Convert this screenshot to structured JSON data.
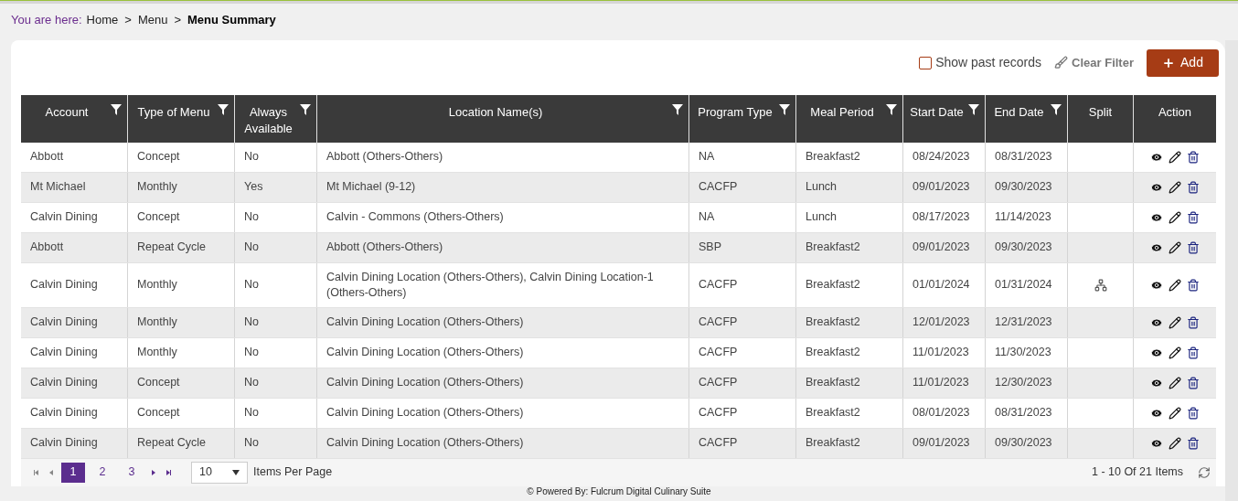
{
  "breadcrumb": {
    "prefix": "You are here:",
    "items": [
      {
        "label": "Home",
        "current": false
      },
      {
        "label": "Menu",
        "current": false
      },
      {
        "label": "Menu Summary",
        "current": true
      }
    ],
    "separator": ">"
  },
  "toolbar": {
    "show_past_records": {
      "label": "Show past records",
      "checked": false
    },
    "clear_filter": "Clear Filter",
    "add": "Add"
  },
  "table": {
    "columns": [
      {
        "label": "Account",
        "filter": true
      },
      {
        "label": "Type of Menu",
        "filter": true
      },
      {
        "label": "Always Available",
        "filter": true
      },
      {
        "label": "Location Name(s)",
        "filter": true
      },
      {
        "label": "Program Type",
        "filter": true
      },
      {
        "label": "Meal Period",
        "filter": true
      },
      {
        "label": "Start Date",
        "filter": true
      },
      {
        "label": "End Date",
        "filter": true
      },
      {
        "label": "Split",
        "filter": false
      },
      {
        "label": "Action",
        "filter": false
      }
    ],
    "rows": [
      {
        "cells": [
          "Abbott",
          "Concept",
          "No",
          "Abbott (Others-Others)",
          "NA",
          "Breakfast2",
          "08/24/2023",
          "08/31/2023"
        ],
        "split": false
      },
      {
        "cells": [
          "Mt Michael",
          "Monthly",
          "Yes",
          "Mt Michael (9-12)",
          "CACFP",
          "Lunch",
          "09/01/2023",
          "09/30/2023"
        ],
        "split": false
      },
      {
        "cells": [
          "Calvin Dining",
          "Concept",
          "No",
          "Calvin - Commons (Others-Others)",
          "NA",
          "Lunch",
          "08/17/2023",
          "11/14/2023"
        ],
        "split": false
      },
      {
        "cells": [
          "Abbott",
          "Repeat Cycle",
          "No",
          "Abbott (Others-Others)",
          "SBP",
          "Breakfast2",
          "09/01/2023",
          "09/30/2023"
        ],
        "split": false
      },
      {
        "cells": [
          "Calvin Dining",
          "Monthly",
          "No",
          "Calvin Dining Location (Others-Others), Calvin Dining Location-1 (Others-Others)",
          "CACFP",
          "Breakfast2",
          "01/01/2024",
          "01/31/2024"
        ],
        "split": true
      },
      {
        "cells": [
          "Calvin Dining",
          "Monthly",
          "No",
          "Calvin Dining Location (Others-Others)",
          "CACFP",
          "Breakfast2",
          "12/01/2023",
          "12/31/2023"
        ],
        "split": false
      },
      {
        "cells": [
          "Calvin Dining",
          "Monthly",
          "No",
          "Calvin Dining Location (Others-Others)",
          "CACFP",
          "Breakfast2",
          "11/01/2023",
          "11/30/2023"
        ],
        "split": false
      },
      {
        "cells": [
          "Calvin Dining",
          "Concept",
          "No",
          "Calvin Dining Location (Others-Others)",
          "CACFP",
          "Breakfast2",
          "11/01/2023",
          "12/30/2023"
        ],
        "split": false
      },
      {
        "cells": [
          "Calvin Dining",
          "Concept",
          "No",
          "Calvin Dining Location (Others-Others)",
          "CACFP",
          "Breakfast2",
          "08/01/2023",
          "08/31/2023"
        ],
        "split": false
      },
      {
        "cells": [
          "Calvin Dining",
          "Repeat Cycle",
          "No",
          "Calvin Dining Location (Others-Others)",
          "CACFP",
          "Breakfast2",
          "09/01/2023",
          "09/30/2023"
        ],
        "split": false
      }
    ]
  },
  "pager": {
    "pages": [
      {
        "label": "1",
        "selected": true
      },
      {
        "label": "2",
        "selected": false
      },
      {
        "label": "3",
        "selected": false
      }
    ],
    "page_size": "10",
    "page_size_label": "Items Per Page",
    "summary": "1 - 10 Of 21 Items"
  },
  "footer": "© Powered By: Fulcrum Digital Culinary Suite"
}
